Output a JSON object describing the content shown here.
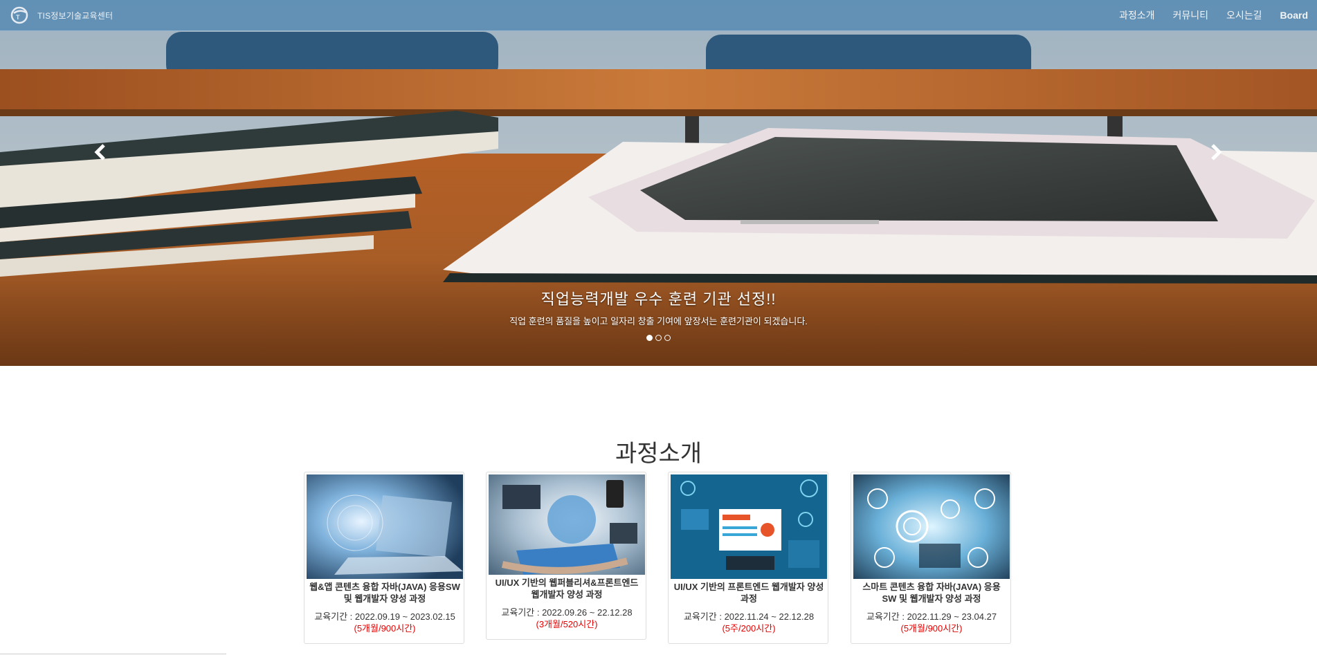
{
  "nav": {
    "brand": "TIS정보기술교육센터",
    "items": [
      "과정소개",
      "커뮤니티",
      "오시는길",
      "Board"
    ]
  },
  "hero": {
    "title": "직업능력개발 우수 훈련 기관 선정!!",
    "subtitle": "직업 훈련의 품질을 높이고 일자리 창출 기여에 앞장서는 훈련기관이 되겠습니다.",
    "slides": 3,
    "active_slide": 1,
    "prev_icon": "chevron-left-icon",
    "next_icon": "chevron-right-icon"
  },
  "courses": {
    "title": "과정소개",
    "items": [
      {
        "title": "웹&앱 콘텐츠 융합 자바(JAVA) 응용SW 및 웹개발자 양성 과정",
        "period": "교육기간 : 2022.09.19 ~ 2023.02.15",
        "duration": "(5개월/900시간)"
      },
      {
        "title": "UI/UX 기반의 웹퍼블리셔&프론트엔드 웹개발자 양성 과정",
        "period": "교육기간 : 2022.09.26 ~ 22.12.28",
        "duration": "(3개월/520시간)"
      },
      {
        "title": "UI/UX 기반의 프론트엔드 웹개발자 양성 과정",
        "period": "교육기간 : 2022.11.24 ~ 22.12.28",
        "duration": "(5주/200시간)"
      },
      {
        "title": "스마트 콘텐츠 융합 자바(JAVA) 응용 SW 및 웹개발자 양성 과정",
        "period": "교육기간 : 2022.11.29 ~ 23.04.27",
        "duration": "(5개월/900시간)"
      }
    ]
  },
  "colors": {
    "navbar": "#5a8cb4",
    "duration_text": "#e60000",
    "title_text": "#333333"
  }
}
